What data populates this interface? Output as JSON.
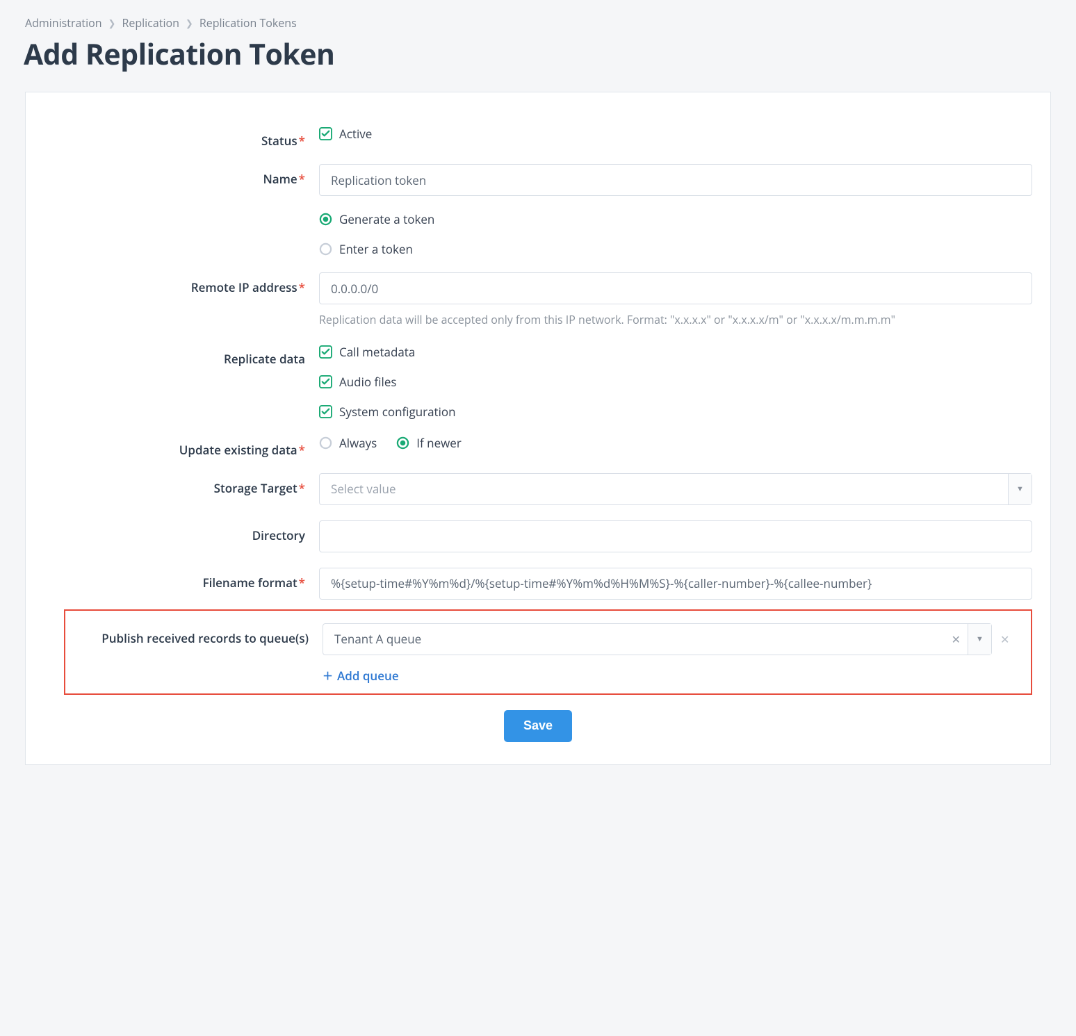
{
  "breadcrumb": {
    "items": [
      "Administration",
      "Replication",
      "Replication Tokens"
    ]
  },
  "page": {
    "title": "Add Replication Token"
  },
  "form": {
    "status": {
      "label": "Status",
      "required": true,
      "active_label": "Active",
      "checked": true
    },
    "name": {
      "label": "Name",
      "required": true,
      "value": "Replication token"
    },
    "token_mode": {
      "generate_label": "Generate a token",
      "enter_label": "Enter a token",
      "selected": "generate"
    },
    "remote_ip": {
      "label": "Remote IP address",
      "required": true,
      "value": "0.0.0.0/0",
      "hint": "Replication data will be accepted only from this IP network. Format: \"x.x.x.x\" or \"x.x.x.x/m\" or \"x.x.x.x/m.m.m.m\""
    },
    "replicate": {
      "label": "Replicate data",
      "items": [
        {
          "label": "Call metadata",
          "checked": true
        },
        {
          "label": "Audio files",
          "checked": true
        },
        {
          "label": "System configuration",
          "checked": true
        }
      ]
    },
    "update": {
      "label": "Update existing data",
      "required": true,
      "always_label": "Always",
      "ifnewer_label": "If newer",
      "selected": "ifnewer"
    },
    "storage": {
      "label": "Storage Target",
      "required": true,
      "placeholder": "Select value",
      "value": ""
    },
    "directory": {
      "label": "Directory",
      "value": ""
    },
    "filename": {
      "label": "Filename format",
      "required": true,
      "value": "%{setup-time#%Y%m%d}/%{setup-time#%Y%m%d%H%M%S}-%{caller-number}-%{callee-number}"
    },
    "queues": {
      "label": "Publish received records to queue(s)",
      "items": [
        {
          "value": "Tenant A queue"
        }
      ],
      "add_label": "Add queue"
    },
    "save_label": "Save"
  }
}
